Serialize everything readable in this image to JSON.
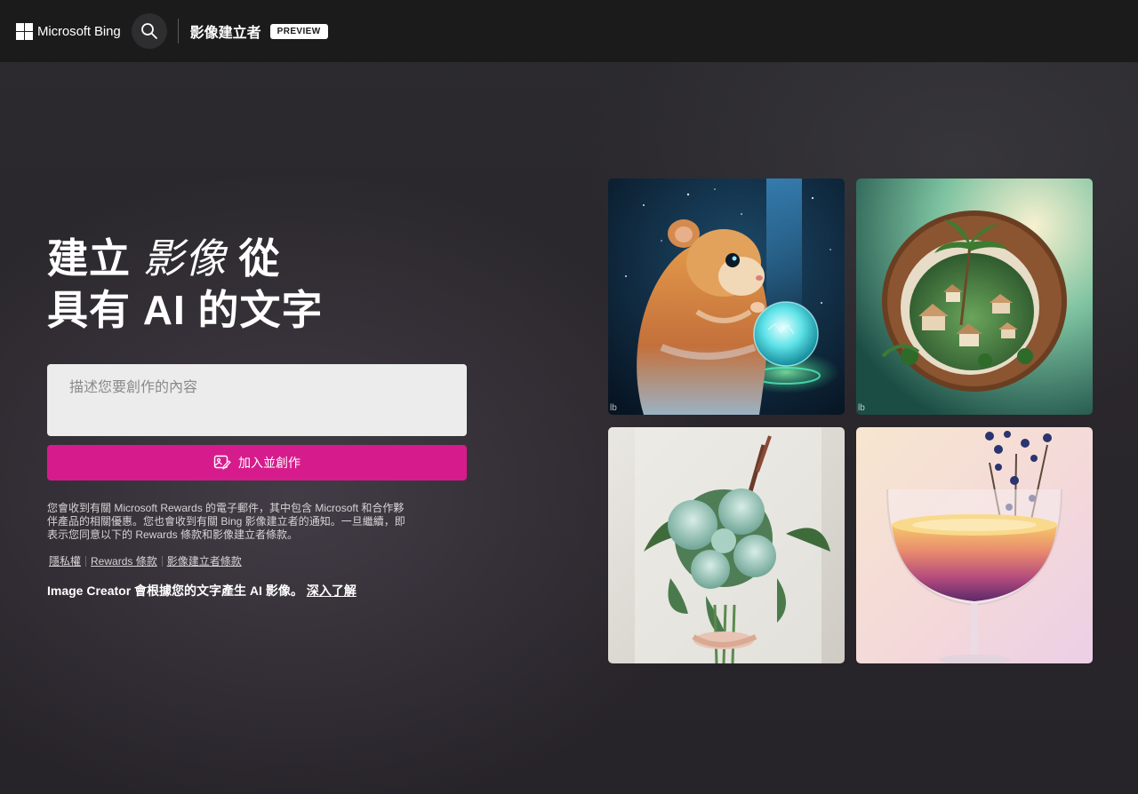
{
  "header": {
    "brand": "Microsoft Bing",
    "product_title": "影像建立者",
    "badge": "PREVIEW"
  },
  "hero": {
    "line1_a": "建立 ",
    "line1_italic": "影像",
    "line1_b": " 從",
    "line2": "具有 AI 的文字"
  },
  "prompt": {
    "placeholder": "描述您要創作的內容",
    "value": ""
  },
  "join_button": {
    "label": "加入並創作"
  },
  "notice": "您會收到有關 Microsoft Rewards 的電子郵件，其中包含 Microsoft 和合作夥伴產品的相關優惠。您也會收到有關 Bing 影像建立者的通知。一旦繼續，即表示您同意以下的 Rewards 條款和影像建立者條款。",
  "links": [
    "隱私權",
    "Rewards 條款",
    "影像建立者條款"
  ],
  "info": {
    "text": "Image Creator 會根據您的文字產生 AI 影像。",
    "link": "深入了解"
  },
  "gallery": [
    {
      "mark": "lb"
    },
    {
      "mark": "lb"
    },
    {
      "mark": ""
    },
    {
      "mark": ""
    }
  ],
  "colors": {
    "header_bg": "#1c1b1c",
    "accent": "#d61c8c",
    "input_bg": "#ececec"
  }
}
